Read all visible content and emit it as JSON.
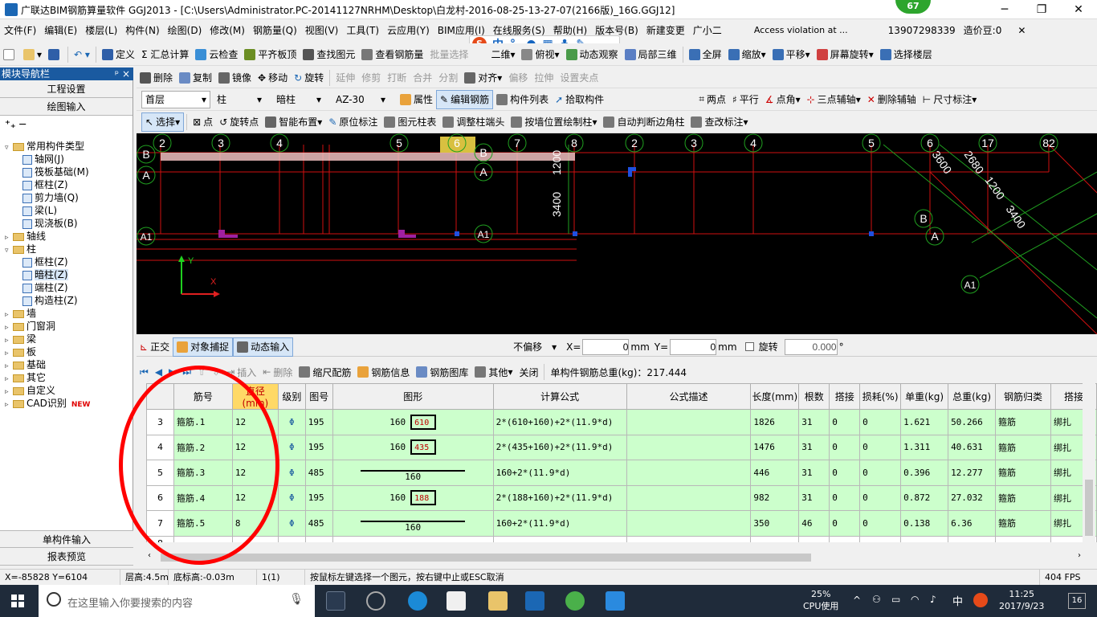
{
  "window": {
    "title": "广联达BIM钢筋算量软件 GGJ2013 - [C:\\Users\\Administrator.PC-20141127NRHM\\Desktop\\白龙村-2016-08-25-13-27-07(2166版)_16G.GGJ12]",
    "badge": "67"
  },
  "menu": [
    "文件(F)",
    "编辑(E)",
    "楼层(L)",
    "构件(N)",
    "绘图(D)",
    "修改(M)",
    "钢筋量(Q)",
    "视图(V)",
    "工具(T)",
    "云应用(Y)",
    "BIM应用(I)",
    "在线服务(S)",
    "帮助(H)",
    "版本号(B)",
    "新建变更",
    "广小二",
    "Access violation at ...",
    "13907298339",
    "造价豆:0"
  ],
  "toolbar1": [
    "定义",
    "Σ 汇总计算",
    "云检查",
    "平齐板顶",
    "查找图元",
    "查看钢筋量",
    "批量选择",
    "二维",
    "俯视",
    "动态观察",
    "局部三维",
    "全屏",
    "缩放",
    "平移",
    "屏幕旋转",
    "选择楼层"
  ],
  "toolbar2": [
    "删除",
    "复制",
    "镜像",
    "移动",
    "旋转",
    "延伸",
    "修剪",
    "打断",
    "合并",
    "分割",
    "对齐",
    "偏移",
    "拉伸",
    "设置夹点"
  ],
  "toolbar3": {
    "floor": "首层",
    "type": "柱",
    "subtype": "暗柱",
    "name": "AZ-30",
    "items": [
      "属性",
      "编辑钢筋",
      "构件列表",
      "拾取构件",
      "两点",
      "平行",
      "点角",
      "三点辅轴",
      "删除辅轴",
      "尺寸标注"
    ]
  },
  "toolbar4": [
    "选择",
    "点",
    "旋转点",
    "智能布置",
    "原位标注",
    "图元柱表",
    "调整柱端头",
    "按墙位置绘制柱",
    "自动判断边角柱",
    "查改标注"
  ],
  "nav": {
    "header": "模块导航栏",
    "tabs": [
      "工程设置",
      "绘图输入"
    ],
    "bottom_tabs": [
      "单构件输入",
      "报表预览"
    ],
    "tree": [
      {
        "label": "常用构件类型",
        "level": 0,
        "kind": "folder",
        "open": true
      },
      {
        "label": "轴网(J)",
        "level": 1,
        "kind": "leaf"
      },
      {
        "label": "筏板基础(M)",
        "level": 1,
        "kind": "leaf"
      },
      {
        "label": "框柱(Z)",
        "level": 1,
        "kind": "leaf"
      },
      {
        "label": "剪力墙(Q)",
        "level": 1,
        "kind": "leaf"
      },
      {
        "label": "梁(L)",
        "level": 1,
        "kind": "leaf"
      },
      {
        "label": "现浇板(B)",
        "level": 1,
        "kind": "leaf"
      },
      {
        "label": "轴线",
        "level": 0,
        "kind": "folder"
      },
      {
        "label": "柱",
        "level": 0,
        "kind": "folder",
        "open": true
      },
      {
        "label": "框柱(Z)",
        "level": 1,
        "kind": "leaf"
      },
      {
        "label": "暗柱(Z)",
        "level": 1,
        "kind": "leaf",
        "selected": true
      },
      {
        "label": "端柱(Z)",
        "level": 1,
        "kind": "leaf"
      },
      {
        "label": "构造柱(Z)",
        "level": 1,
        "kind": "leaf"
      },
      {
        "label": "墙",
        "level": 0,
        "kind": "folder"
      },
      {
        "label": "门窗洞",
        "level": 0,
        "kind": "folder"
      },
      {
        "label": "梁",
        "level": 0,
        "kind": "folder"
      },
      {
        "label": "板",
        "level": 0,
        "kind": "folder"
      },
      {
        "label": "基础",
        "level": 0,
        "kind": "folder"
      },
      {
        "label": "其它",
        "level": 0,
        "kind": "folder"
      },
      {
        "label": "自定义",
        "level": 0,
        "kind": "folder"
      },
      {
        "label": "CAD识别",
        "level": 0,
        "kind": "folder",
        "badge": "NEW"
      }
    ]
  },
  "canvas": {
    "axes_top": [
      "2",
      "3",
      "4",
      "5",
      "6",
      "7",
      "8",
      "2",
      "3",
      "4",
      "5",
      "6",
      "7",
      "8"
    ],
    "axes_top_extra": [
      "17",
      "82"
    ],
    "axes_left": [
      "B",
      "A",
      "A1"
    ],
    "axis_markers": [
      "B",
      "A",
      "A1",
      "A",
      "B",
      "A",
      "A1"
    ],
    "dimensions": [
      "1200",
      "3400",
      "3600",
      "2680",
      "1200",
      "3400"
    ],
    "axis_labels": {
      "x": "X",
      "y": "Y"
    }
  },
  "bottombar": {
    "items": [
      "正交",
      "对象捕捉",
      "动态输入"
    ],
    "offset_mode": "不偏移",
    "x_label": "X=",
    "x_value": "0",
    "x_unit": "mm",
    "y_label": "Y=",
    "y_value": "0",
    "y_unit": "mm",
    "rotate_label": "旋转",
    "rotate_value": "0.000",
    "deg": "°"
  },
  "gridtb": {
    "items": [
      "插入",
      "删除",
      "缩尺配筋",
      "钢筋信息",
      "钢筋图库",
      "其他",
      "关闭"
    ],
    "total_label": "单构件钢筋总重(kg)：217.444"
  },
  "grid": {
    "headers": [
      "",
      "筋号",
      "直径(mm)",
      "级别",
      "图号",
      "图形",
      "计算公式",
      "公式描述",
      "长度(mm)",
      "根数",
      "搭接",
      "损耗(%)",
      "单重(kg)",
      "总重(kg)",
      "钢筋归类",
      "搭接"
    ],
    "rows": [
      {
        "n": "3",
        "name": "箍筋.1",
        "dia": "12",
        "grade": "Φ",
        "fig": "195",
        "s1": "160",
        "s2": "610",
        "formula": "2*(610+160)+2*(11.9*d)",
        "desc": "",
        "len": "1826",
        "count": "31",
        "lap": "0",
        "loss": "0",
        "unit": "1.621",
        "total": "50.266",
        "cat": "箍筋",
        "lapt": "绑扎"
      },
      {
        "n": "4",
        "name": "箍筋.2",
        "dia": "12",
        "grade": "Φ",
        "fig": "195",
        "s1": "160",
        "s2": "435",
        "formula": "2*(435+160)+2*(11.9*d)",
        "desc": "",
        "len": "1476",
        "count": "31",
        "lap": "0",
        "loss": "0",
        "unit": "1.311",
        "total": "40.631",
        "cat": "箍筋",
        "lapt": "绑扎"
      },
      {
        "n": "5",
        "name": "箍筋.3",
        "dia": "12",
        "grade": "Φ",
        "fig": "485",
        "s1": "160",
        "s2": "",
        "formula": "160+2*(11.9*d)",
        "desc": "",
        "len": "446",
        "count": "31",
        "lap": "0",
        "loss": "0",
        "unit": "0.396",
        "total": "12.277",
        "cat": "箍筋",
        "lapt": "绑扎"
      },
      {
        "n": "6",
        "name": "箍筋.4",
        "dia": "12",
        "grade": "Φ",
        "fig": "195",
        "s1": "160",
        "s2": "188",
        "formula": "2*(188+160)+2*(11.9*d)",
        "desc": "",
        "len": "982",
        "count": "31",
        "lap": "0",
        "loss": "0",
        "unit": "0.872",
        "total": "27.032",
        "cat": "箍筋",
        "lapt": "绑扎"
      },
      {
        "n": "7",
        "name": "箍筋.5",
        "dia": "8",
        "grade": "Φ",
        "fig": "485",
        "s1": "160",
        "s2": "",
        "formula": "160+2*(11.9*d)",
        "desc": "",
        "len": "350",
        "count": "46",
        "lap": "0",
        "loss": "0",
        "unit": "0.138",
        "total": "6.36",
        "cat": "箍筋",
        "lapt": "绑扎"
      },
      {
        "n": "8",
        "empty": true
      }
    ]
  },
  "status": {
    "coords": "X=-85828 Y=6104",
    "floor_height": "层高:4.5m",
    "bottom_height": "底标高:-0.03m",
    "count": "1(1)",
    "hint": "按鼠标左键选择一个图元，按右键中止或ESC取消",
    "fps": "404 FPS"
  },
  "taskbar": {
    "search_placeholder": "在这里输入你要搜索的内容",
    "cpu": "25%",
    "cpu_label": "CPU使用",
    "ime": "中",
    "time": "11:25",
    "date": "2017/9/23",
    "notif": "16"
  }
}
